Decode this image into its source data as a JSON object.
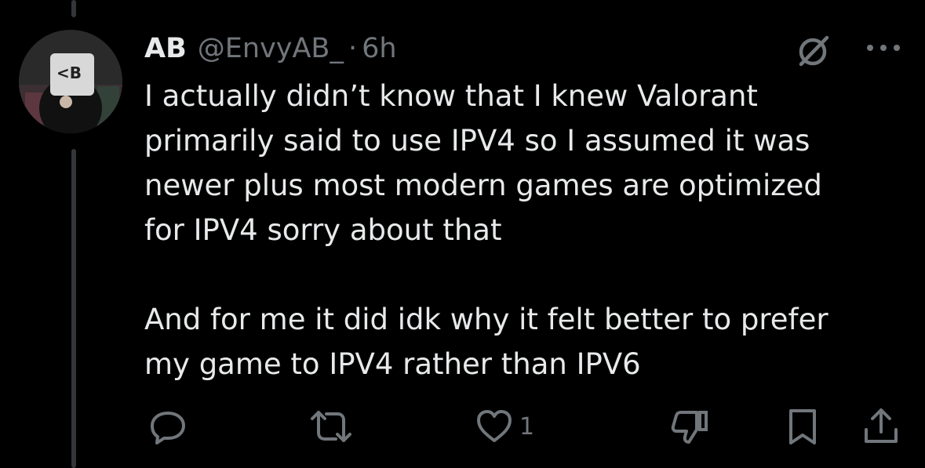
{
  "tweet": {
    "author": {
      "name": "AB",
      "handle": "@EnvyAB_",
      "avatar_text": "<B"
    },
    "separator": "·",
    "timestamp": "6h",
    "text": "I actually didn’t know that I knew Valorant\nprimarily said to use IPV4 so I assumed it was\nnewer plus most modern games are optimized\nfor IPV4 sorry about that\n\nAnd for me it did idk why it felt better to prefer\nmy game to IPV4 rather than IPV6",
    "header_icons": [
      "grok-icon",
      "more-icon"
    ]
  },
  "actions": {
    "reply": {
      "icon": "reply-icon",
      "count": ""
    },
    "repost": {
      "icon": "repost-icon",
      "count": ""
    },
    "like": {
      "icon": "heart-icon",
      "count": "1"
    },
    "downvote": {
      "icon": "thumbs-down-icon",
      "count": ""
    },
    "bookmark": {
      "icon": "bookmark-icon",
      "count": ""
    },
    "share": {
      "icon": "share-icon",
      "count": ""
    }
  },
  "colors": {
    "background": "#000000",
    "text_primary": "#e7e9ea",
    "text_secondary": "#71767b",
    "thread_line": "#333639"
  }
}
